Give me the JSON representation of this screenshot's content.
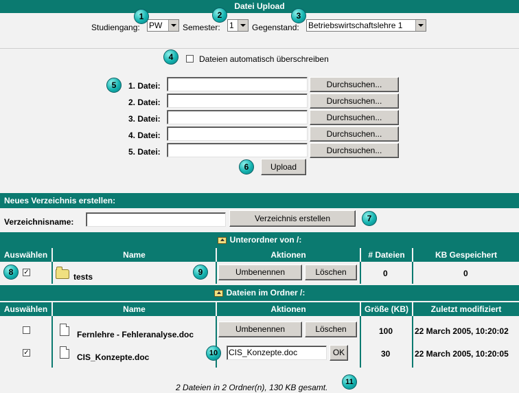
{
  "upload": {
    "title": "Datei Upload",
    "studiengang_label": "Studiengang:",
    "studiengang_value": "PW",
    "semester_label": "Semester:",
    "semester_value": "1",
    "gegenstand_label": "Gegenstand:",
    "gegenstand_value": "Betriebswirtschaftslehre 1",
    "overwrite_label": "Dateien automatisch überschreiben",
    "overwrite_checked": false,
    "file_rows": [
      {
        "label": "1. Datei:",
        "value": "",
        "button": "Durchsuchen..."
      },
      {
        "label": "2. Datei:",
        "value": "",
        "button": "Durchsuchen..."
      },
      {
        "label": "3. Datei:",
        "value": "",
        "button": "Durchsuchen..."
      },
      {
        "label": "4. Datei:",
        "value": "",
        "button": "Durchsuchen..."
      },
      {
        "label": "5. Datei:",
        "value": "",
        "button": "Durchsuchen..."
      }
    ],
    "upload_button": "Upload"
  },
  "new_dir": {
    "title": "Neues Verzeichnis erstellen:",
    "name_label": "Verzeichnisname:",
    "name_value": "",
    "create_button": "Verzeichnis erstellen"
  },
  "subfolders": {
    "title": "Unterordner von /:",
    "columns": [
      "Auswählen",
      "Name",
      "Aktionen",
      "# Dateien",
      "KB Gespeichert"
    ],
    "rows": [
      {
        "checked": true,
        "name": "tests",
        "rename": "Umbenennen",
        "delete": "Löschen",
        "files": "0",
        "kb": "0"
      }
    ]
  },
  "files": {
    "title": "Dateien im Ordner /:",
    "columns": [
      "Auswählen",
      "Name",
      "Aktionen",
      "Größe (KB)",
      "Zuletzt modifiziert"
    ],
    "rows": [
      {
        "checked": false,
        "name": "Fernlehre - Fehleranalyse.doc",
        "rename": "Umbenennen",
        "delete": "Löschen",
        "size": "100",
        "modified": "22 March 2005, 10:20:02"
      },
      {
        "checked": true,
        "name": "CIS_Konzepte.doc",
        "rename_value": "CIS_Konzepte.doc",
        "ok": "OK",
        "size": "30",
        "modified": "22 March 2005, 10:20:05"
      }
    ]
  },
  "summary": "2 Dateien in 2 Ordner(n), 130 KB gesamt.",
  "markers": [
    "1",
    "2",
    "3",
    "4",
    "5",
    "6",
    "7",
    "8",
    "9",
    "10",
    "11"
  ],
  "colors": {
    "header_bg": "#0b7a70",
    "panel_bg": "#f2f2f2",
    "marker": "#14b3b0"
  },
  "icons": [
    "folder-icon",
    "document-icon",
    "folder-up-icon",
    "checkbox-icon",
    "dropdown-arrow-icon"
  ]
}
